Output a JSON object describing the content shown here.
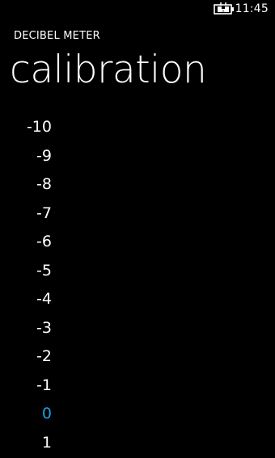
{
  "status_bar": {
    "time": "11:45",
    "battery_icon": "battery-charging-icon"
  },
  "app": {
    "title": "DECIBEL METER"
  },
  "page": {
    "title": "calibration"
  },
  "colors": {
    "background": "#000000",
    "text": "#ffffff",
    "accent": "#1ba1e2"
  },
  "calibration": {
    "selected": "0",
    "items": [
      "-10",
      "-9",
      "-8",
      "-7",
      "-6",
      "-5",
      "-4",
      "-3",
      "-2",
      "-1",
      "0",
      "1"
    ]
  }
}
